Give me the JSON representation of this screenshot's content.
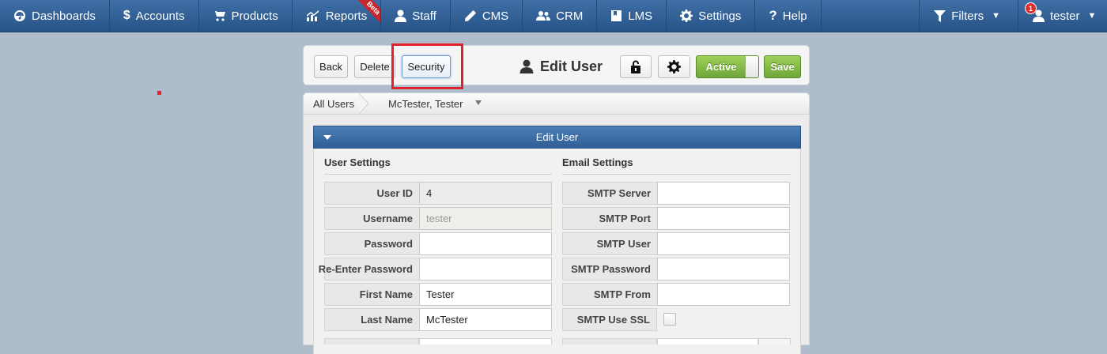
{
  "nav": {
    "items": [
      {
        "label": "Dashboards",
        "icon": "dashboard-icon"
      },
      {
        "label": "Accounts",
        "icon": "dollar-icon"
      },
      {
        "label": "Products",
        "icon": "cart-icon"
      },
      {
        "label": "Reports",
        "icon": "chart-icon",
        "badge": "Beta"
      },
      {
        "label": "Staff",
        "icon": "user-icon"
      },
      {
        "label": "CMS",
        "icon": "pencil-icon"
      },
      {
        "label": "CRM",
        "icon": "users-icon"
      },
      {
        "label": "LMS",
        "icon": "book-icon"
      },
      {
        "label": "Settings",
        "icon": "gear-icon"
      },
      {
        "label": "Help",
        "icon": "question-icon"
      }
    ],
    "filters_label": "Filters",
    "user_label": "tester",
    "notification_count": "1"
  },
  "toolbar": {
    "back_label": "Back",
    "delete_label": "Delete",
    "security_label": "Security",
    "title": "Edit User",
    "active_label": "Active",
    "save_label": "Save"
  },
  "breadcrumb": {
    "root": "All Users",
    "current": "McTester, Tester"
  },
  "section": {
    "title": "Edit User"
  },
  "user_settings": {
    "title": "User Settings",
    "user_id_label": "User ID",
    "user_id_value": "4",
    "username_label": "Username",
    "username_value": "tester",
    "password_label": "Password",
    "password_value": "",
    "reenter_password_label": "Re-Enter Password",
    "reenter_password_value": "",
    "first_name_label": "First Name",
    "first_name_value": "Tester",
    "last_name_label": "Last Name",
    "last_name_value": "McTester"
  },
  "email_settings": {
    "title": "Email Settings",
    "smtp_server_label": "SMTP Server",
    "smtp_server_value": "",
    "smtp_port_label": "SMTP Port",
    "smtp_port_value": "",
    "smtp_user_label": "SMTP User",
    "smtp_user_value": "",
    "smtp_password_label": "SMTP Password",
    "smtp_password_value": "",
    "smtp_from_label": "SMTP From",
    "smtp_from_value": "",
    "smtp_use_ssl_label": "SMTP Use SSL",
    "smtp_use_ssl_checked": false
  },
  "colors": {
    "nav_bg": "#2f5f96",
    "page_bg": "#afbccb",
    "accent_green": "#7cb342",
    "highlight_red": "#e0202b"
  }
}
